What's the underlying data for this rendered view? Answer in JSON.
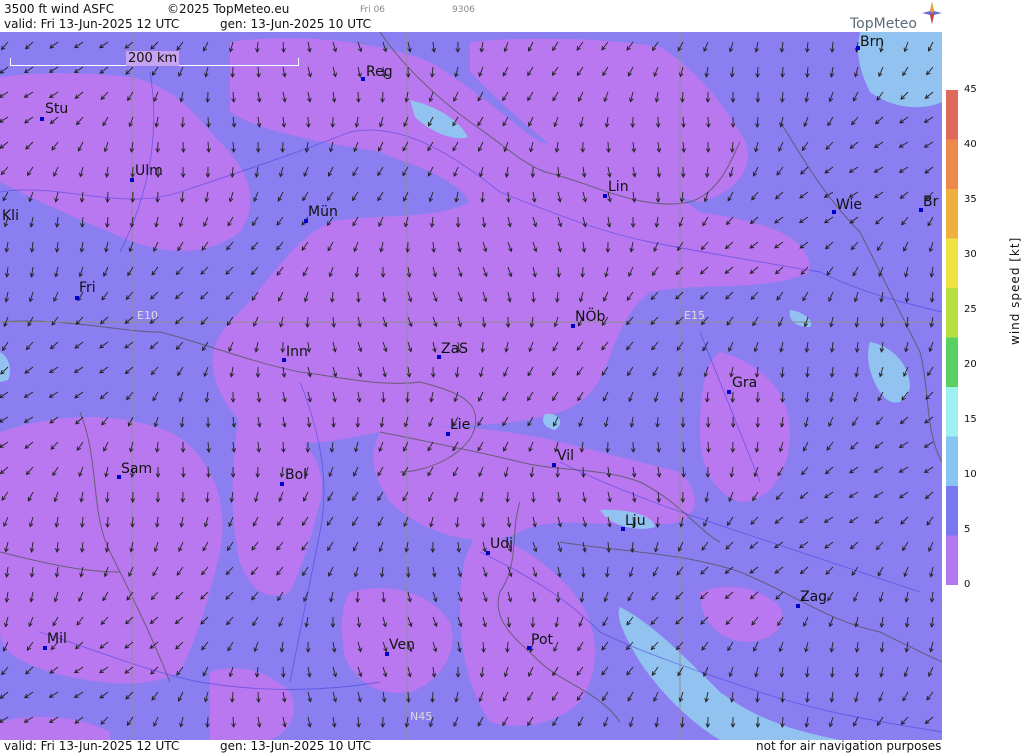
{
  "header": {
    "title": "3500 ft wind ASFC",
    "copyright": "©2025 TopMeteo.eu",
    "day_code": "Fri 06",
    "code": "9306",
    "valid": "valid:  Fri  13-Jun-2025  12 UTC",
    "gen": "gen: 13-Jun-2025 10 UTC"
  },
  "brand": {
    "name": "TopMeteo",
    "logo": "compass-star-logo"
  },
  "scale_bar": {
    "label": "200 km"
  },
  "grid_labels": {
    "lon1": "E10",
    "lon2": "E15",
    "lat": "N45"
  },
  "cities": [
    {
      "name": "Stu"
    },
    {
      "name": "Reg"
    },
    {
      "name": "Brn"
    },
    {
      "name": "Ulm"
    },
    {
      "name": "Kli"
    },
    {
      "name": "Mün"
    },
    {
      "name": "Lin"
    },
    {
      "name": "Wie"
    },
    {
      "name": "Br"
    },
    {
      "name": "Fri"
    },
    {
      "name": "NÖb"
    },
    {
      "name": "Inn"
    },
    {
      "name": "ZaS"
    },
    {
      "name": "Gra"
    },
    {
      "name": "Lie"
    },
    {
      "name": "Vil"
    },
    {
      "name": "Sam"
    },
    {
      "name": "Bol"
    },
    {
      "name": "Lju"
    },
    {
      "name": "Udi"
    },
    {
      "name": "Zag"
    },
    {
      "name": "Mil"
    },
    {
      "name": "Ven"
    },
    {
      "name": "Pot"
    }
  ],
  "colorbar": {
    "title": "wind speed [kt]",
    "ticks": [
      "45",
      "40",
      "35",
      "30",
      "25",
      "20",
      "15",
      "10",
      "5",
      "0"
    ],
    "colors": [
      "#e06a5a",
      "#ec8a4e",
      "#f0b040",
      "#f0e040",
      "#b8e040",
      "#5ad060",
      "#9ef0f0",
      "#88c4f0",
      "#7a78f0",
      "#b478f0"
    ]
  },
  "map_colors": {
    "calm": "#b978ef",
    "light": "#8a7ef0",
    "moderate": "#92c2f0"
  },
  "footer": {
    "valid": "valid:  Fri  13-Jun-2025  12 UTC",
    "gen": "gen: 13-Jun-2025 10 UTC",
    "note": "not for air navigation purposes"
  }
}
